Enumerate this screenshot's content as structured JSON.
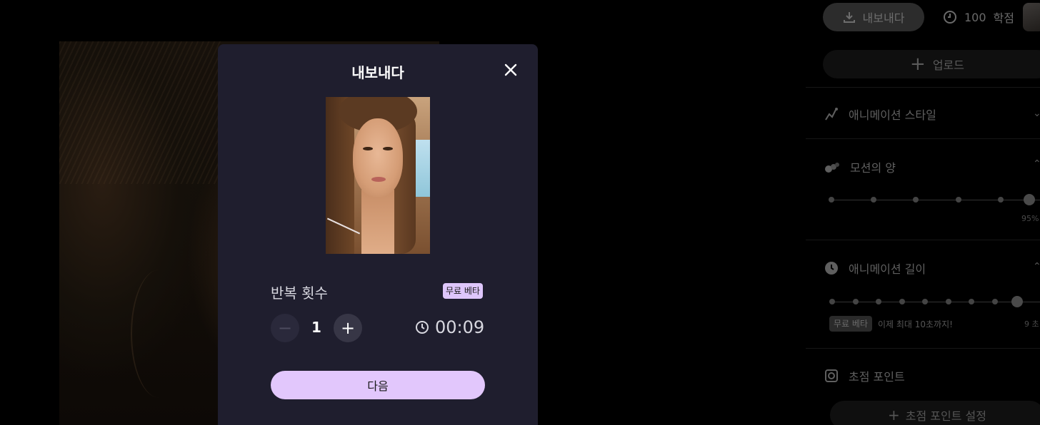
{
  "header": {
    "export_label": "내보내다",
    "credits_value": "100",
    "credits_unit": "학점"
  },
  "sidebar": {
    "upload_label": "업로드",
    "animation_style_label": "애니메이션 스타일",
    "motion_amount": {
      "label": "모션의 양",
      "value_text": "95%",
      "level_percent": 95
    },
    "animation_length": {
      "label": "애니메이션 길이",
      "beta_badge": "무료 베타",
      "beta_note": "이제 최대 10초까지!",
      "value_text": "9 초"
    },
    "focus_point": {
      "label": "초점 포인트",
      "button_label": "초점 포인트 설정"
    }
  },
  "modal": {
    "title": "내보내다",
    "repeat_label": "반복 횟수",
    "beta_badge": "무료 베타",
    "repeat_count": "1",
    "duration": "00:09",
    "next_label": "다음"
  },
  "colors": {
    "accent": "#e2c7fc",
    "modal_bg": "#1f1e2e",
    "badge": "#dec6fb"
  }
}
